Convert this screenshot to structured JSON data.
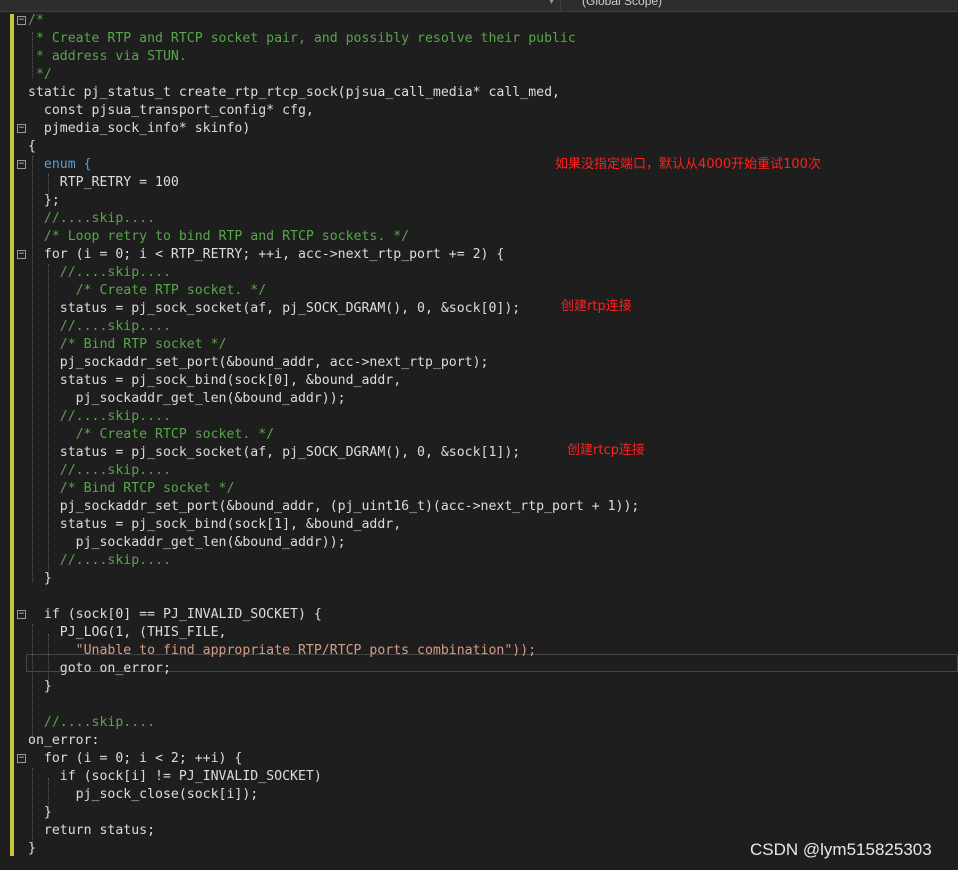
{
  "toolbar": {
    "scope_label": "(Global Scope)"
  },
  "code_lines": [
    "/*",
    " * Create RTP and RTCP socket pair, and possibly resolve their public",
    " * address via STUN.",
    " */",
    "static pj_status_t create_rtp_rtcp_sock(pjsua_call_media* call_med,",
    "  const pjsua_transport_config* cfg,",
    "  pjmedia_sock_info* skinfo)",
    "{",
    "  enum {",
    "    RTP_RETRY = 100",
    "  };",
    "  //....skip....",
    "  /* Loop retry to bind RTP and RTCP sockets. */",
    "  for (i = 0; i < RTP_RETRY; ++i, acc->next_rtp_port += 2) {",
    "    //....skip....",
    "      /* Create RTP socket. */",
    "    status = pj_sock_socket(af, pj_SOCK_DGRAM(), 0, &sock[0]);",
    "    //....skip....",
    "    /* Bind RTP socket */",
    "    pj_sockaddr_set_port(&bound_addr, acc->next_rtp_port);",
    "    status = pj_sock_bind(sock[0], &bound_addr,",
    "      pj_sockaddr_get_len(&bound_addr));",
    "    //....skip....",
    "      /* Create RTCP socket. */",
    "    status = pj_sock_socket(af, pj_SOCK_DGRAM(), 0, &sock[1]);",
    "    //....skip....",
    "    /* Bind RTCP socket */",
    "    pj_sockaddr_set_port(&bound_addr, (pj_uint16_t)(acc->next_rtp_port + 1));",
    "    status = pj_sock_bind(sock[1], &bound_addr,",
    "      pj_sockaddr_get_len(&bound_addr));",
    "    //....skip....",
    "  }",
    "",
    "  if (sock[0] == PJ_INVALID_SOCKET) {",
    "    PJ_LOG(1, (THIS_FILE,",
    "      \"Unable to find appropriate RTP/RTCP ports combination\"));",
    "    goto on_error;",
    "  }",
    "",
    "  //....skip....",
    "on_error:",
    "  for (i = 0; i < 2; ++i) {",
    "    if (sock[i] != PJ_INVALID_SOCKET)",
    "      pj_sock_close(sock[i]);",
    "  }",
    "  return status;",
    "}"
  ],
  "annotations": {
    "retry_note": "如果没指定端口，默认从4000开始重试100次",
    "rtp_note": "创建rtp连接",
    "rtcp_note": "创建rtcp连接"
  },
  "watermark": "CSDN @lym515825303"
}
